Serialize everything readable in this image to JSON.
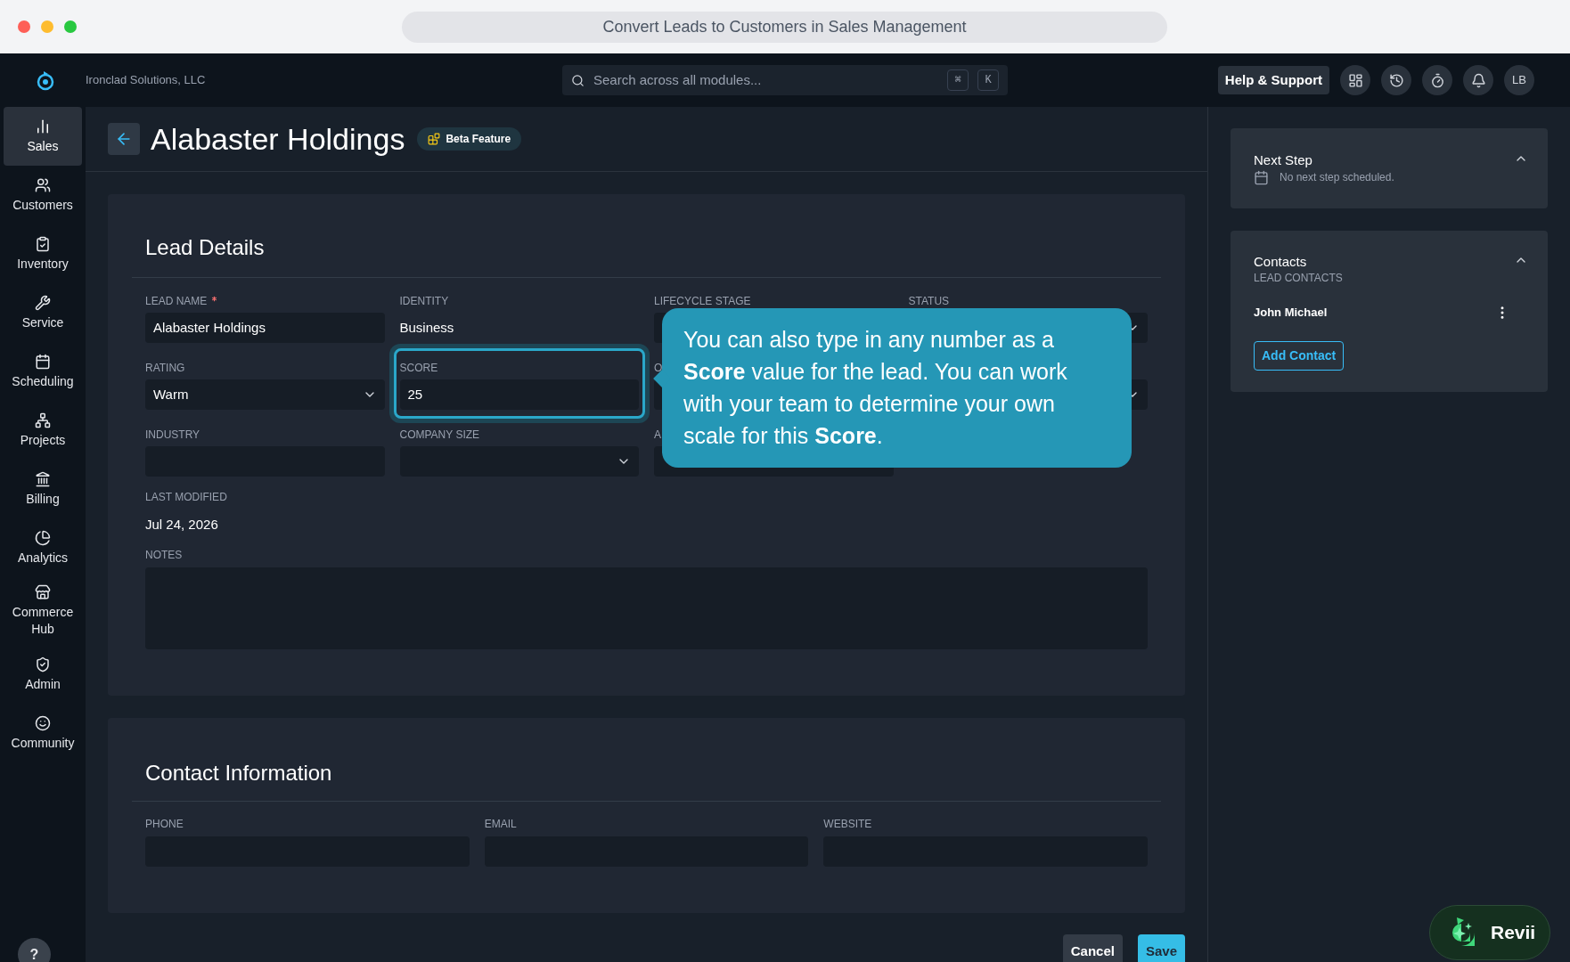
{
  "window": {
    "title": "Convert Leads to Customers in Sales Management"
  },
  "top_bar": {
    "company": "Ironclad Solutions, LLC",
    "search": {
      "placeholder": "Search across all modules...",
      "keys": [
        "⌘",
        "K"
      ]
    },
    "help_button": "Help & Support",
    "avatar": "LB"
  },
  "sidebar": {
    "items": [
      {
        "label": "Sales",
        "selected": true
      },
      {
        "label": "Customers",
        "selected": false
      },
      {
        "label": "Inventory",
        "selected": false
      },
      {
        "label": "Service",
        "selected": false
      },
      {
        "label": "Scheduling",
        "selected": false
      },
      {
        "label": "Projects",
        "selected": false
      },
      {
        "label": "Billing",
        "selected": false
      },
      {
        "label": "Analytics",
        "selected": false
      },
      {
        "label": "Commerce Hub",
        "selected": false
      },
      {
        "label": "Admin",
        "selected": false
      },
      {
        "label": "Community",
        "selected": false
      }
    ],
    "help": "?"
  },
  "page": {
    "title": "Alabaster Holdings",
    "badge": "Beta Feature"
  },
  "lead_details": {
    "title": "Lead Details",
    "fields": [
      {
        "kind": "input",
        "label": "LEAD NAME",
        "required": true,
        "value": "Alabaster Holdings",
        "highlighted": false
      },
      {
        "kind": "text",
        "label": "IDENTITY",
        "required": false,
        "value": "Business",
        "highlighted": false
      },
      {
        "kind": "input",
        "label": "LIFECYCLE STAGE",
        "required": false,
        "highlighted": false
      },
      {
        "kind": "select",
        "label": "STATUS",
        "required": false,
        "highlighted": false
      },
      {
        "kind": "select",
        "label": "RATING",
        "required": false,
        "value": "Warm",
        "highlighted": false
      },
      {
        "kind": "input",
        "label": "SCORE",
        "required": false,
        "value": "25",
        "highlighted": true
      },
      {
        "kind": "input",
        "label": "O",
        "highlighted": false
      },
      {
        "kind": "select",
        "highlighted": false
      },
      {
        "kind": "input",
        "label": "INDUSTRY",
        "required": false,
        "highlighted": false
      },
      {
        "kind": "select",
        "label": "COMPANY SIZE",
        "required": false,
        "highlighted": false
      },
      {
        "kind": "input",
        "label": "A",
        "highlighted": false
      }
    ],
    "last_modified": {
      "label": "LAST MODIFIED",
      "value": "Jul 24, 2026"
    },
    "notes": {
      "label": "NOTES"
    }
  },
  "tooltip": {
    "text": "You can also type in any number as a **Score** value for the lead. You can work with your team to determine your own scale for this **Score**."
  },
  "contact_information": {
    "title": "Contact Information",
    "fields": [
      {
        "label": "PHONE"
      },
      {
        "label": "EMAIL"
      },
      {
        "label": "WEBSITE"
      }
    ]
  },
  "actions": [
    "Cancel",
    "Save"
  ],
  "next_step": {
    "title": "Next Step",
    "empty": "No next step scheduled.",
    "expanded": true
  },
  "contacts": {
    "title": "Contacts",
    "subtitle": "LEAD CONTACTS",
    "expanded": true,
    "items": [
      "John Michael"
    ],
    "add_button": "Add Contact"
  },
  "assistant": {
    "label": "Revii"
  }
}
